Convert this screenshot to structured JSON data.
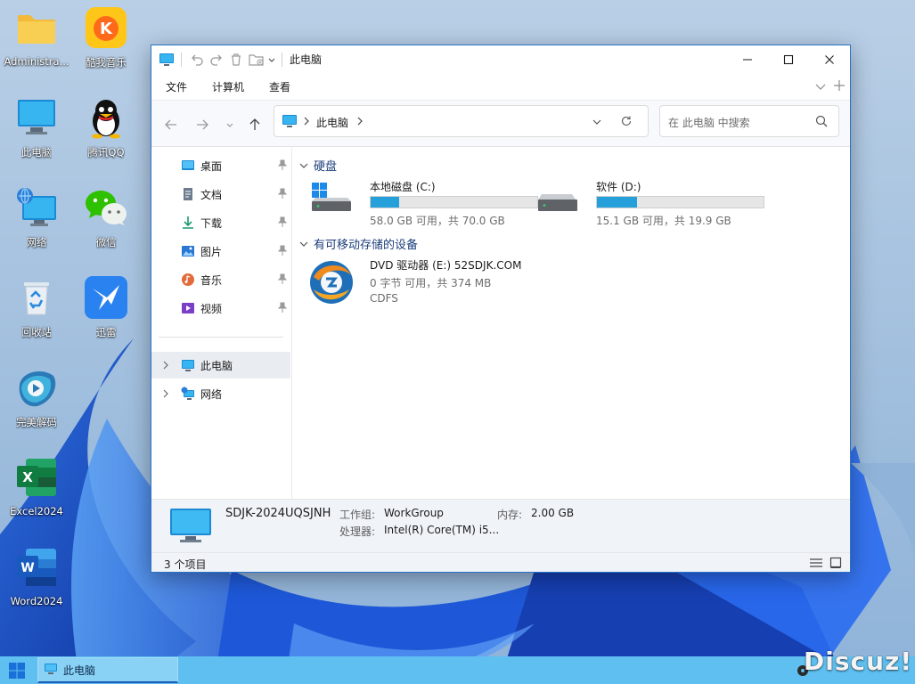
{
  "desktop": {
    "icons": [
      {
        "label": "Administra...",
        "icon": "folder-icon"
      },
      {
        "label": "酷我音乐",
        "icon": "kuwo-music-icon"
      },
      {
        "label": "此电脑",
        "icon": "this-pc-icon"
      },
      {
        "label": "腾讯QQ",
        "icon": "qq-icon"
      },
      {
        "label": "网络",
        "icon": "network-icon"
      },
      {
        "label": "微信",
        "icon": "wechat-icon"
      },
      {
        "label": "回收站",
        "icon": "recycle-bin-icon"
      },
      {
        "label": "迅雷",
        "icon": "xunlei-icon"
      },
      {
        "label": "完美解码",
        "icon": "potplayer-icon"
      },
      {
        "label": "Excel2024",
        "icon": "excel-icon"
      },
      {
        "label": "Word2024",
        "icon": "word-icon"
      }
    ]
  },
  "window": {
    "title": "此电脑",
    "menu": [
      "文件",
      "计算机",
      "查看"
    ],
    "address": {
      "segment": "此电脑"
    },
    "search": {
      "placeholder": "在 此电脑 中搜索"
    },
    "sidebar": {
      "quick_access": [
        {
          "label": "桌面",
          "icon": "desktop-icon"
        },
        {
          "label": "文档",
          "icon": "documents-icon"
        },
        {
          "label": "下载",
          "icon": "downloads-icon"
        },
        {
          "label": "图片",
          "icon": "pictures-icon"
        },
        {
          "label": "音乐",
          "icon": "music-icon"
        },
        {
          "label": "视频",
          "icon": "videos-icon"
        }
      ],
      "tree": [
        {
          "label": "此电脑",
          "icon": "this-pc-icon",
          "selected": true
        },
        {
          "label": "网络",
          "icon": "network-icon",
          "selected": false
        }
      ]
    },
    "groups": {
      "hard_disks": "硬盘",
      "removable": "有可移动存储的设备"
    },
    "drives": [
      {
        "name": "本地磁盘 (C:)",
        "size": "58.0 GB 可用，共 70.0 GB",
        "used_fraction": 0.17
      },
      {
        "name": "软件 (D:)",
        "size": "15.1 GB 可用，共 19.9 GB",
        "used_fraction": 0.24
      }
    ],
    "dvd": {
      "name": "DVD 驱动器 (E:) 52SDJK.COM",
      "size": "0 字节 可用，共 374 MB",
      "fs": "CDFS"
    },
    "details": {
      "computer_name": "SDJK-2024UQSJNH",
      "workgroup_label": "工作组:",
      "workgroup_value": "WorkGroup",
      "memory_label": "内存:",
      "memory_value": "2.00 GB",
      "cpu_label": "处理器:",
      "cpu_value": "Intel(R) Core(TM) i5..."
    },
    "status": {
      "item_count": "3 个项目"
    }
  },
  "taskbar": {
    "task_label": "此电脑"
  },
  "watermark": "Discuz!",
  "colors": {
    "accent": "#0078d4",
    "drive_bar": "#26a0da",
    "group_heading": "#1c3c7c",
    "taskbar": "#5fbff0"
  }
}
